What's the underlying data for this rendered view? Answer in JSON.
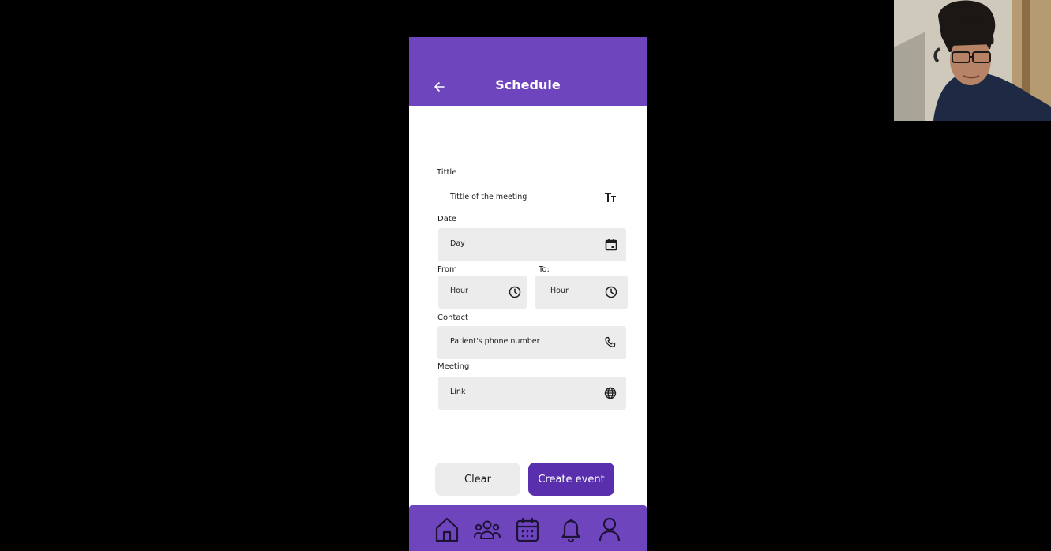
{
  "header": {
    "title": "Schedule"
  },
  "form": {
    "title_label": "Tittle",
    "title_placeholder": "Tittle of the meeting",
    "date_label": "Date",
    "date_placeholder": "Day",
    "from_label": "From",
    "from_placeholder": "Hour",
    "to_label": "To:",
    "to_placeholder": "Hour",
    "contact_label": "Contact",
    "contact_placeholder": "Patient's phone number",
    "meeting_label": "Meeting",
    "meeting_placeholder": "Link"
  },
  "actions": {
    "clear_label": "Clear",
    "create_label": "Create event"
  },
  "bottom_nav": {
    "items": [
      {
        "icon": "home-icon"
      },
      {
        "icon": "users-icon"
      },
      {
        "icon": "calendar-icon"
      },
      {
        "icon": "bell-icon"
      },
      {
        "icon": "profile-icon"
      }
    ]
  },
  "colors": {
    "primary": "#6f45be",
    "button_primary": "#5a2fae",
    "field_bg": "#ececec",
    "background": "#000000"
  }
}
